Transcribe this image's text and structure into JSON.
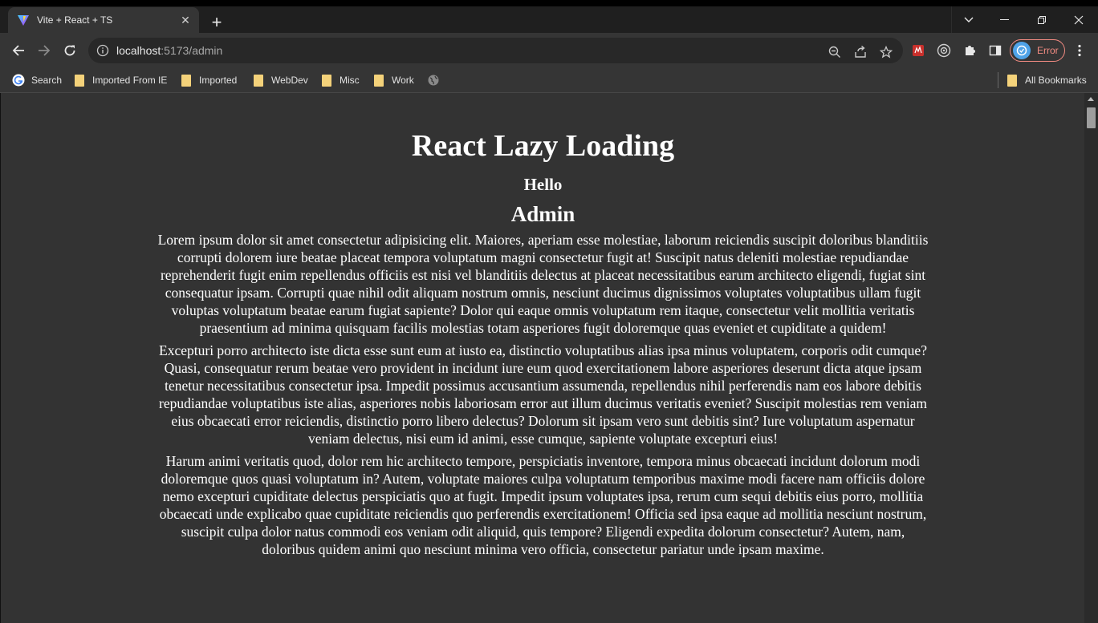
{
  "browser": {
    "tab_title": "Vite + React + TS",
    "url_host": "localhost",
    "url_rest": ":5173/admin",
    "profile_status": "Error",
    "bookmarks": [
      "Search",
      "Imported From IE",
      "Imported",
      "WebDev",
      "Misc",
      "Work"
    ],
    "all_bookmarks_label": "All Bookmarks",
    "icons": {
      "favicon": "vite-icon",
      "close": "close-icon",
      "new_tab": "plus-icon",
      "back": "back-arrow-icon",
      "forward": "forward-arrow-icon",
      "reload": "reload-icon",
      "site_info": "info-icon",
      "zoom": "zoom-out-icon",
      "share": "share-icon",
      "star": "star-icon",
      "extensions": "puzzle-icon",
      "side_panel": "side-panel-icon",
      "menu": "kebab-menu-icon"
    },
    "colors": {
      "error_accent": "#f28b82",
      "page_background": "#333333",
      "chrome_background": "#353535"
    }
  },
  "page": {
    "title": "React Lazy Loading",
    "greeting": "Hello",
    "section_heading": "Admin",
    "paragraphs": [
      "Lorem ipsum dolor sit amet consectetur adipisicing elit. Maiores, aperiam esse molestiae, laborum reiciendis suscipit doloribus blanditiis corrupti dolorem iure beatae placeat tempora voluptatum magni consectetur fugit at! Suscipit natus deleniti molestiae repudiandae reprehenderit fugit enim repellendus officiis est nisi vel blanditiis delectus at placeat necessitatibus earum architecto eligendi, fugiat sint consequatur ipsam. Corrupti quae nihil odit aliquam nostrum omnis, nesciunt ducimus dignissimos voluptates voluptatibus ullam fugit voluptas voluptatum beatae earum fugiat sapiente? Dolor qui eaque omnis voluptatum rem itaque, consectetur velit mollitia veritatis praesentium ad minima quisquam facilis molestias totam asperiores fugit doloremque quas eveniet et cupiditate a quidem!",
      "Excepturi porro architecto iste dicta esse sunt eum at iusto ea, distinctio voluptatibus alias ipsa minus voluptatem, corporis odit cumque? Quasi, consequatur rerum beatae vero provident in incidunt iure eum quod exercitationem labore asperiores deserunt dicta atque ipsam tenetur necessitatibus consectetur ipsa. Impedit possimus accusantium assumenda, repellendus nihil perferendis nam eos labore debitis repudiandae voluptatibus iste alias, asperiores nobis laboriosam error aut illum ducimus veritatis eveniet? Suscipit molestias rem veniam eius obcaecati error reiciendis, distinctio porro libero delectus? Dolorum sit ipsam vero sunt debitis sint? Iure voluptatum aspernatur veniam delectus, nisi eum id animi, esse cumque, sapiente voluptate excepturi eius!",
      "Harum animi veritatis quod, dolor rem hic architecto tempore, perspiciatis inventore, tempora minus obcaecati incidunt dolorum modi doloremque quos quasi voluptatum in? Autem, voluptate maiores culpa voluptatum temporibus maxime modi facere nam officiis dolore nemo excepturi cupiditate delectus perspiciatis quo at fugit. Impedit ipsum voluptates ipsa, rerum cum sequi debitis eius porro, mollitia obcaecati unde explicabo quae cupiditate reiciendis quo perferendis exercitationem! Officia sed ipsa eaque ad mollitia nesciunt nostrum, suscipit culpa dolor natus commodi eos veniam odit aliquid, quis tempore? Eligendi expedita dolorum consectetur? Autem, nam, doloribus quidem animi quo nesciunt minima vero officia, consectetur pariatur unde ipsam maxime."
    ]
  }
}
